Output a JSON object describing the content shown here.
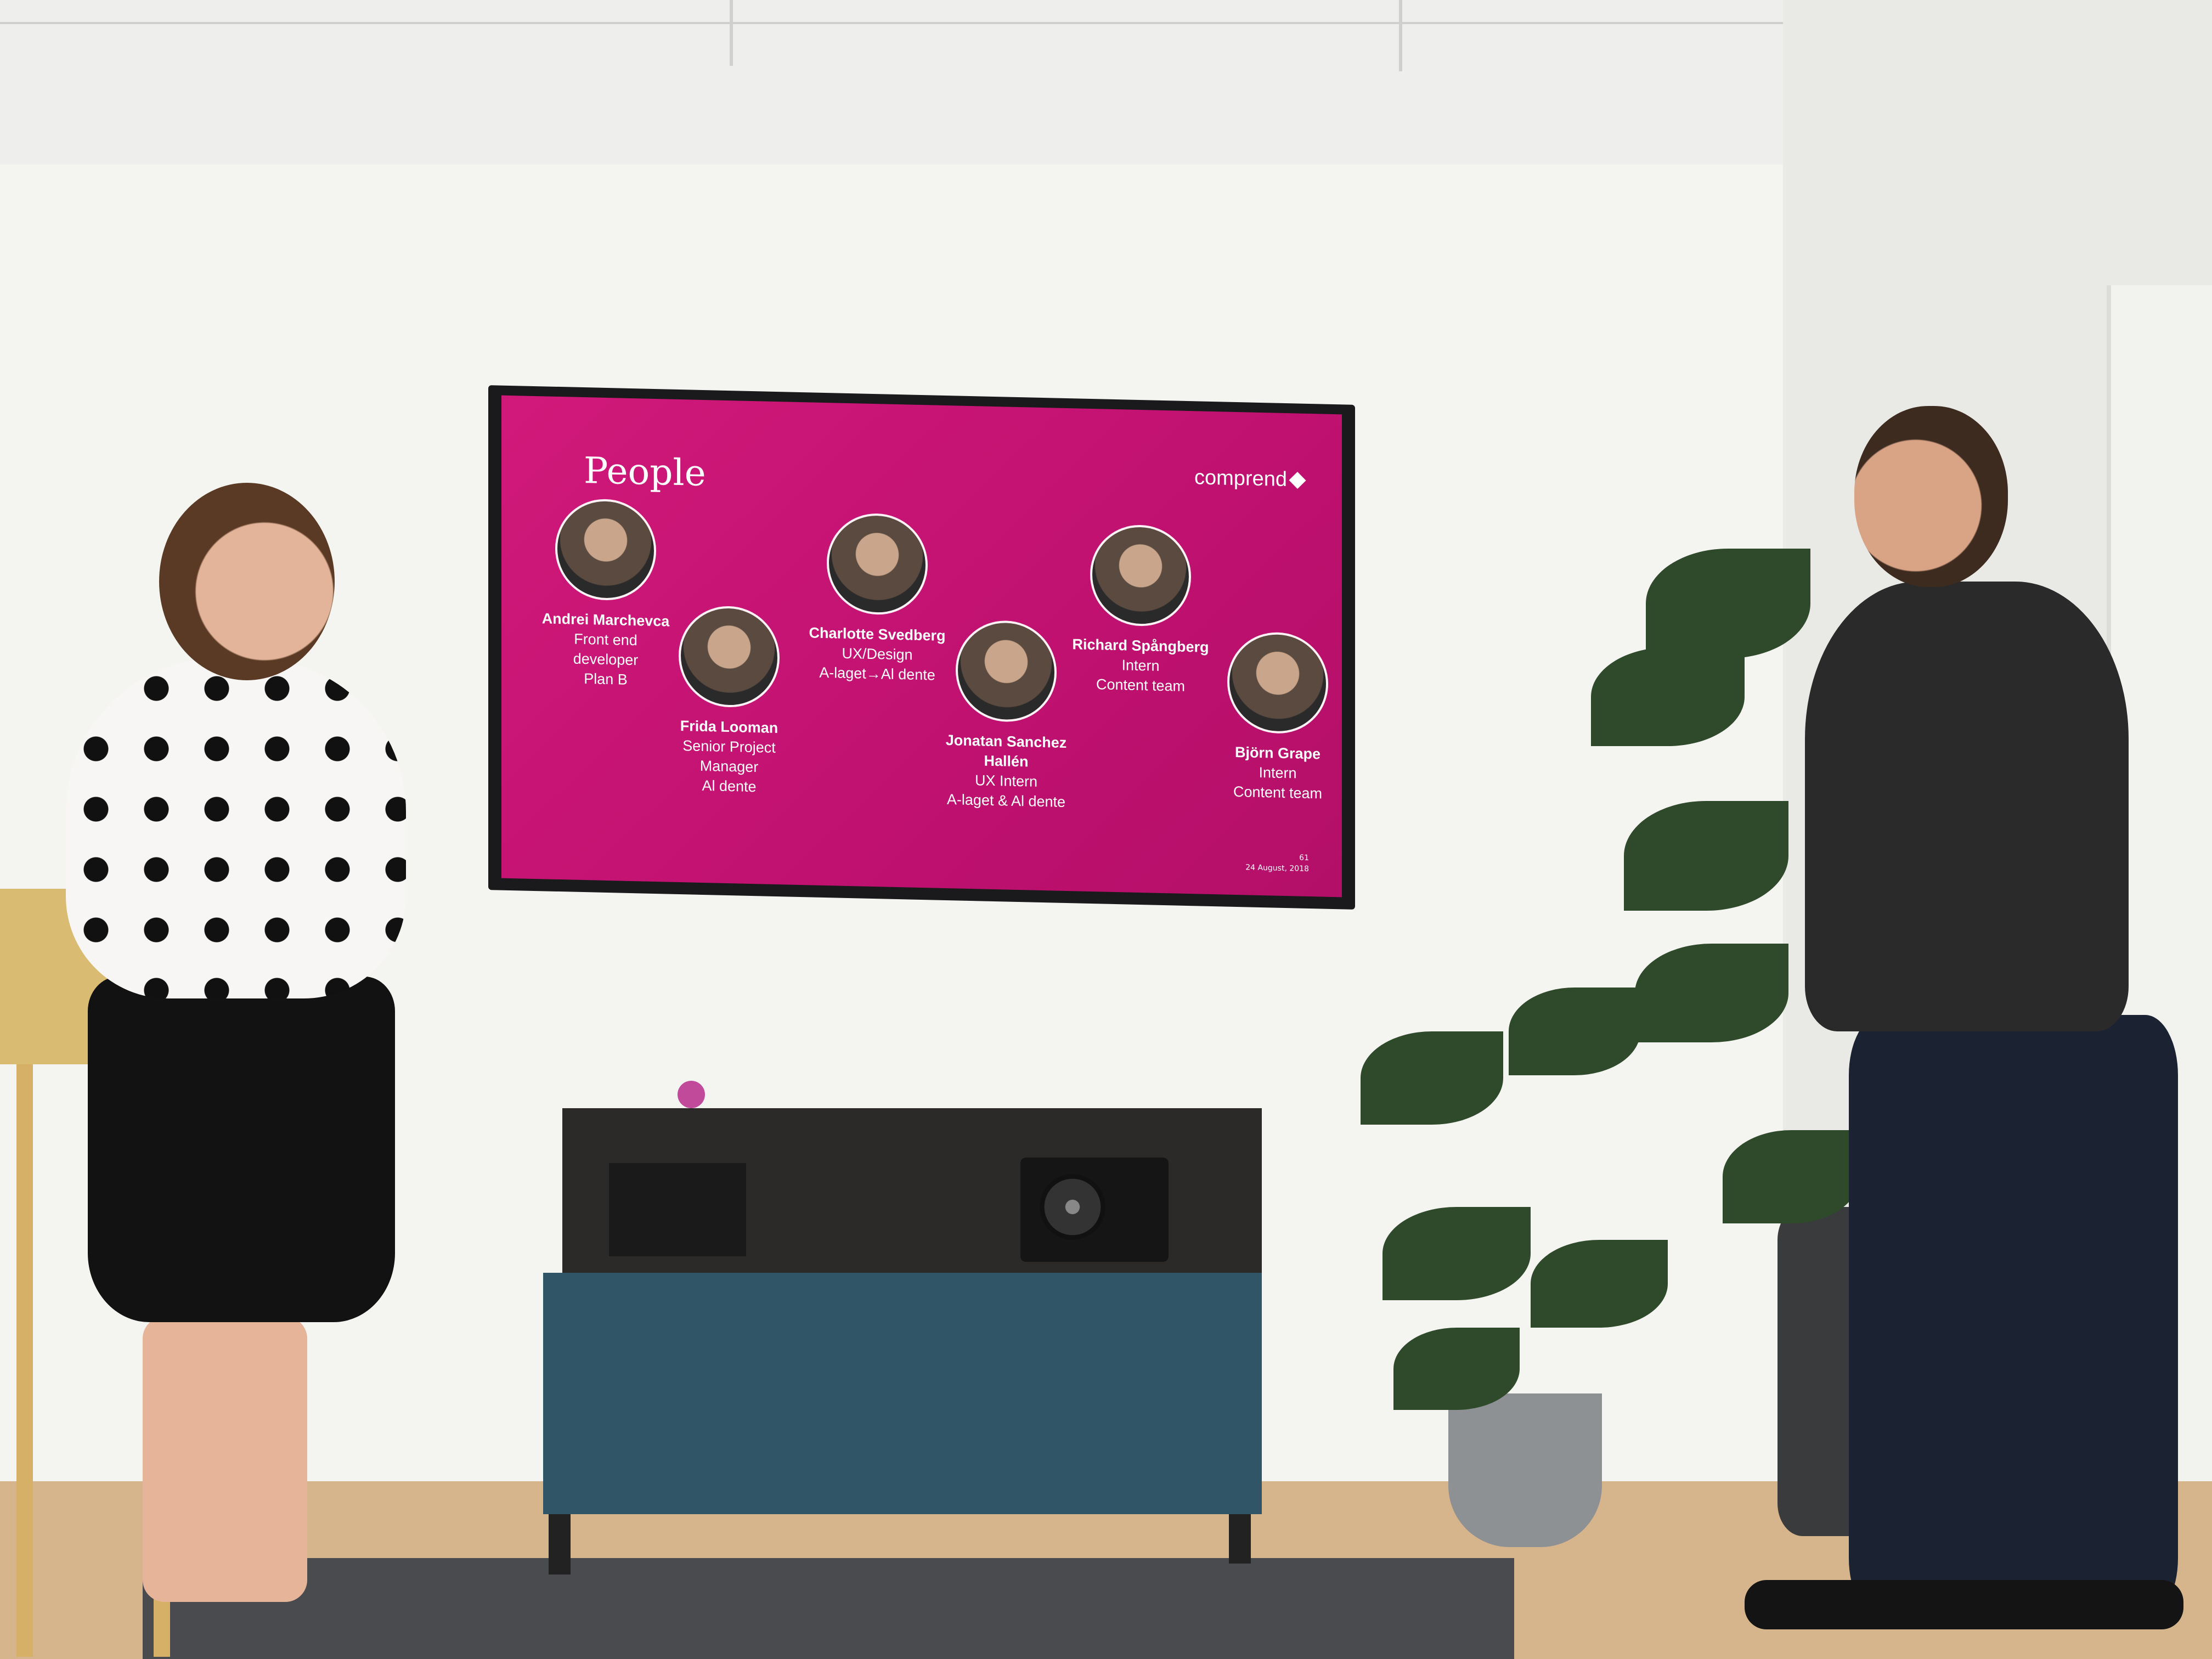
{
  "slide": {
    "title": "People",
    "brand": "comprend",
    "page_number": "61",
    "date": "24 August, 2018",
    "people": [
      {
        "name": "Andrei Marchevca",
        "lines": [
          "Front end",
          "developer",
          "Plan B"
        ]
      },
      {
        "name": "Frida Looman",
        "lines": [
          "Senior Project",
          "Manager",
          "Al dente"
        ]
      },
      {
        "name": "Charlotte Svedberg",
        "lines": [
          "UX/Design",
          "A-laget→Al dente"
        ]
      },
      {
        "name": "Jonatan Sanchez Hallén",
        "lines": [
          "UX Intern",
          "A-laget & Al dente"
        ]
      },
      {
        "name": "Richard Spångberg",
        "lines": [
          "Intern",
          "Content team"
        ]
      },
      {
        "name": "Björn Grape",
        "lines": [
          "Intern",
          "Content team"
        ]
      }
    ]
  },
  "colors": {
    "slide_background": "#c4126f",
    "cabinet_front": "#2f5566"
  }
}
